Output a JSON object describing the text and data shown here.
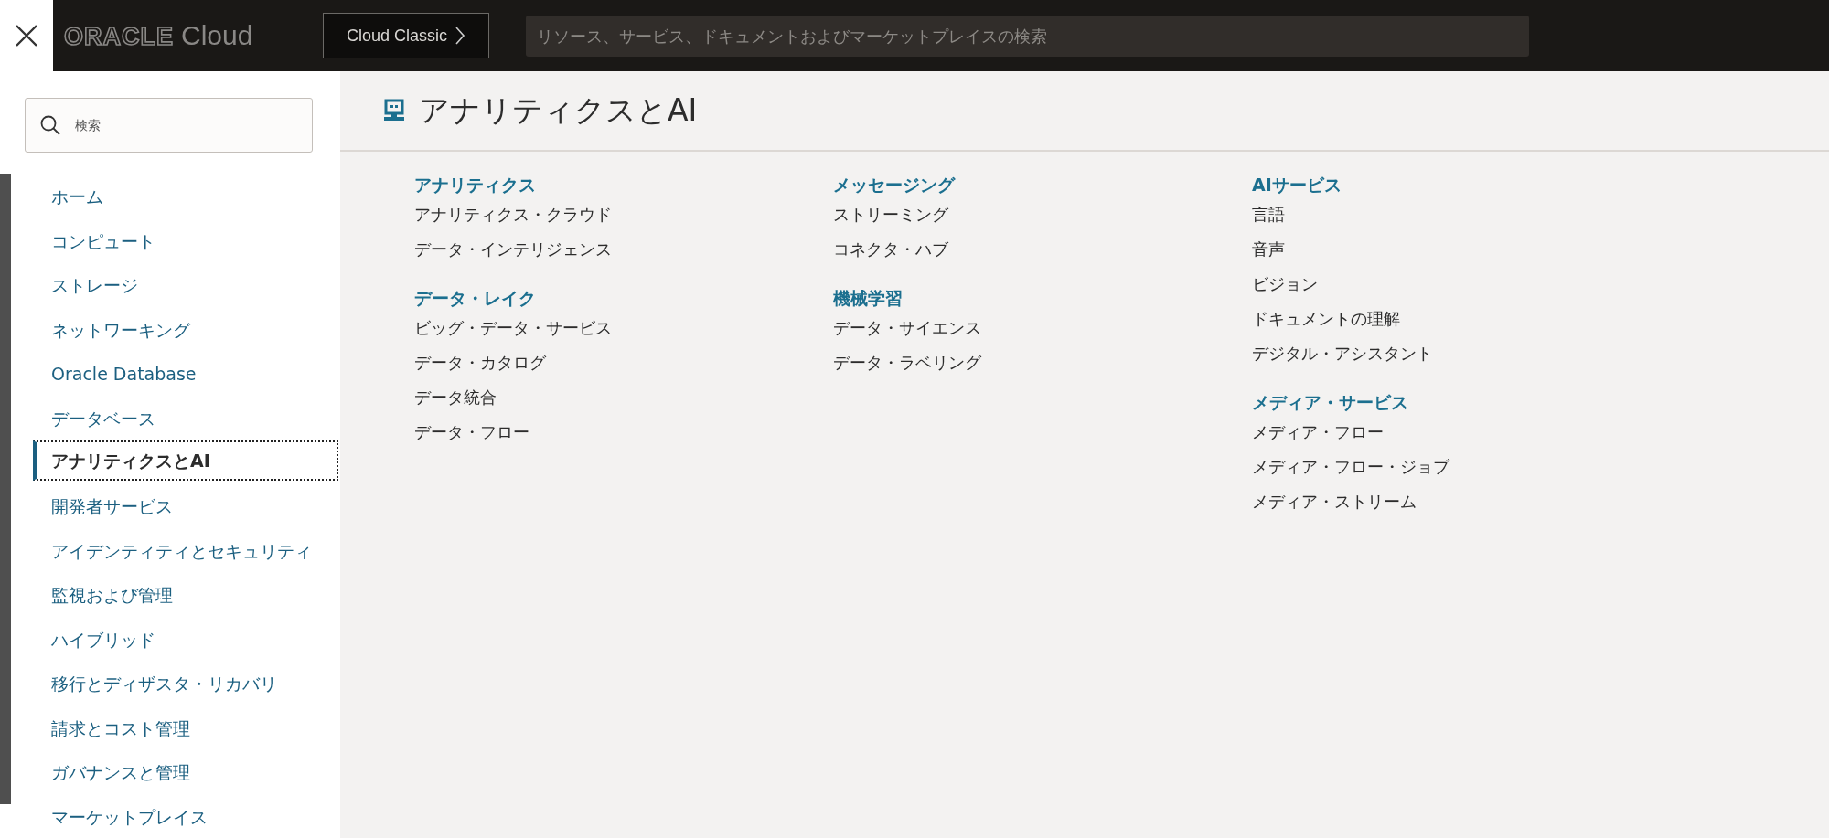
{
  "top_bar": {
    "logo": {
      "brand": "ORACLE",
      "product": "Cloud"
    },
    "classic_button": "Cloud Classic",
    "search": {
      "placeholder": "リソース、サービス、ドキュメントおよびマーケットプレイスの検索"
    }
  },
  "sidebar": {
    "search": {
      "placeholder": "検索"
    },
    "items": [
      {
        "label": "ホーム",
        "selected": false
      },
      {
        "label": "コンピュート",
        "selected": false
      },
      {
        "label": "ストレージ",
        "selected": false
      },
      {
        "label": "ネットワーキング",
        "selected": false
      },
      {
        "label": "Oracle Database",
        "selected": false
      },
      {
        "label": "データベース",
        "selected": false
      },
      {
        "label": "アナリティクスとAI",
        "selected": true
      },
      {
        "label": "開発者サービス",
        "selected": false
      },
      {
        "label": "アイデンティティとセキュリティ",
        "selected": false
      },
      {
        "label": "監視および管理",
        "selected": false
      },
      {
        "label": "ハイブリッド",
        "selected": false
      },
      {
        "label": "移行とディザスタ・リカバリ",
        "selected": false
      },
      {
        "label": "請求とコスト管理",
        "selected": false
      },
      {
        "label": "ガバナンスと管理",
        "selected": false
      },
      {
        "label": "マーケットプレイス",
        "selected": false
      }
    ]
  },
  "content": {
    "title": "アナリティクスとAI",
    "columns": [
      [
        {
          "title": "アナリティクス",
          "items": [
            "アナリティクス・クラウド",
            "データ・インテリジェンス"
          ]
        },
        {
          "title": "データ・レイク",
          "items": [
            "ビッグ・データ・サービス",
            "データ・カタログ",
            "データ統合",
            "データ・フロー"
          ]
        }
      ],
      [
        {
          "title": "メッセージング",
          "items": [
            "ストリーミング",
            "コネクタ・ハブ"
          ]
        },
        {
          "title": "機械学習",
          "items": [
            "データ・サイエンス",
            "データ・ラベリング"
          ]
        }
      ],
      [
        {
          "title": "AIサービス",
          "items": [
            "言語",
            "音声",
            "ビジョン",
            "ドキュメントの理解",
            "デジタル・アシスタント"
          ]
        },
        {
          "title": "メディア・サービス",
          "items": [
            "メディア・フロー",
            "メディア・フロー・ジョブ",
            "メディア・ストリーム"
          ]
        }
      ]
    ]
  }
}
